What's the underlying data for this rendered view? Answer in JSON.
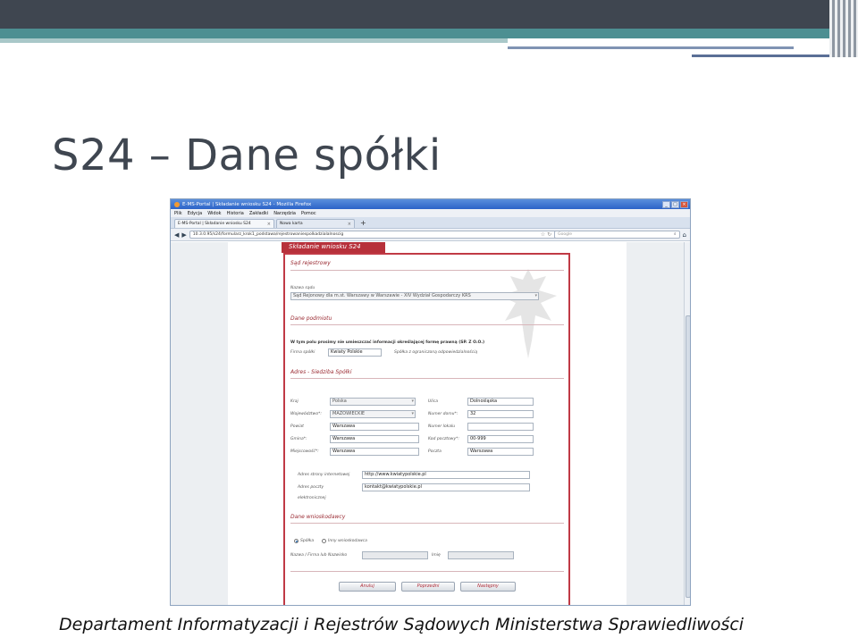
{
  "slide": {
    "title": "S24 – Dane spółki",
    "footer": "Departament Informatyzacji i Rejestrów Sądowych Ministerstwa Sprawiedliwości"
  },
  "browser": {
    "window_title": "E-MS-Portal | Składanie wniosku S24 - Mozilla Firefox",
    "window_buttons": [
      "_",
      "□",
      "×"
    ],
    "menu": [
      "Plik",
      "Edycja",
      "Widok",
      "Historia",
      "Zakładki",
      "Narzędzia",
      "Pomoc"
    ],
    "tabs": [
      {
        "label": "E-MS-Portal | Składanie wniosku S24"
      },
      {
        "label": "Nowa karta"
      }
    ],
    "new_tab": "+",
    "url": "10.3.0.95/s24/formularz_krok1_podstawa/rejestrowaniespolkadzialalnoscig",
    "search_placeholder": "Google"
  },
  "form": {
    "header": "Składanie wniosku S24",
    "sections": {
      "court": "Sąd rejestrowy",
      "entity": "Dane podmiotu",
      "address": "Adres - Siedziba Spółki",
      "submitter": "Dane wnioskodawcy"
    },
    "court": {
      "label": "Nazwa sądu",
      "value": "Sąd Rejonowy dla m.st. Warszawy w Warszawie - XIV Wydział Gospodarczy KRS"
    },
    "entity": {
      "note": "W tym polu prosimy nie umieszczać informacji określającej formę prawną (SP. Z O.O.)",
      "company_label": "Firma spółki",
      "company_value": "Kwiaty Polskie",
      "company_suffix": "Spółka z ograniczoną odpowiedzialnością"
    },
    "address": {
      "left": [
        {
          "label": "Kraj",
          "value": "Polska",
          "kind": "select"
        },
        {
          "label": "Województwo*:",
          "value": "MAZOWIECKIE",
          "kind": "select"
        },
        {
          "label": "Powiat",
          "value": "Warszawa",
          "kind": "input"
        },
        {
          "label": "Gmina*:",
          "value": "Warszawa",
          "kind": "input"
        },
        {
          "label": "Miejscowość*:",
          "value": "Warszawa",
          "kind": "input"
        }
      ],
      "right": [
        {
          "label": "Ulica",
          "value": "Dolnośląska"
        },
        {
          "label": "Numer domu*:",
          "value": "32"
        },
        {
          "label": "Numer lokalu",
          "value": ""
        },
        {
          "label": "Kod pocztowy*:",
          "value": "00-999"
        },
        {
          "label": "Poczta",
          "value": "Warszawa"
        }
      ],
      "website_label": "Adres strony internetowej",
      "website_value": "http://www.kwiatypolskie.pl",
      "email_label_line1": "Adres poczty",
      "email_label_line2": "elektronicznej",
      "email_value": "kontakt@kwiatypolskie.pl"
    },
    "submitter": {
      "radio_company": "Spółka",
      "radio_other": "Inny wnioskodawca",
      "name_label": "Nazwa / Firma lub Nazwisko",
      "firstname_label": "Imię"
    },
    "buttons": {
      "cancel": "Anuluj",
      "previous": "Poprzedni",
      "next": "Następny"
    }
  },
  "colors": {
    "accent_red": "#c03a45",
    "slide_dark": "#3f4650",
    "slide_teal": "#4d8f92"
  }
}
